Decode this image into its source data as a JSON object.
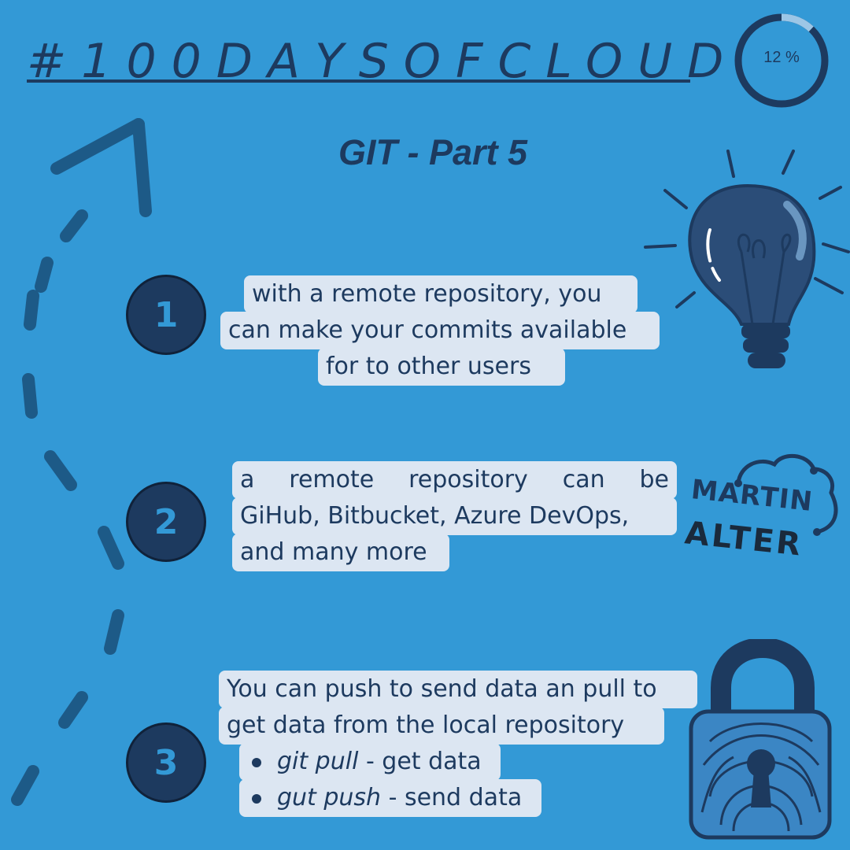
{
  "header": {
    "title": "#100DAYSOFCLOUD",
    "subtitle": "GIT - Part 5",
    "progress_label": "12 %",
    "progress_fraction": 0.12
  },
  "steps": [
    {
      "number": "1",
      "lines": [
        "with a remote repository, you",
        "can make your commits available",
        "for to other users"
      ]
    },
    {
      "number": "2",
      "line1_words": [
        "a",
        "remote",
        "repository",
        "can",
        "be"
      ],
      "line2": "GiHub, Bitbucket, Azure DevOps,",
      "line3": "and many more"
    },
    {
      "number": "3",
      "lines": [
        "You can push to send data an pull to",
        "get data from the local repository"
      ],
      "bullets": [
        {
          "command": "git pull",
          "desc": " - get data"
        },
        {
          "command": "gut push",
          "desc": " - send data"
        }
      ]
    }
  ],
  "logo": {
    "line1": "MARTIN",
    "line2": "ALTER"
  },
  "colors": {
    "background": "#3399d6",
    "dark": "#1d3a5f",
    "bubble": "#dce6f2"
  }
}
